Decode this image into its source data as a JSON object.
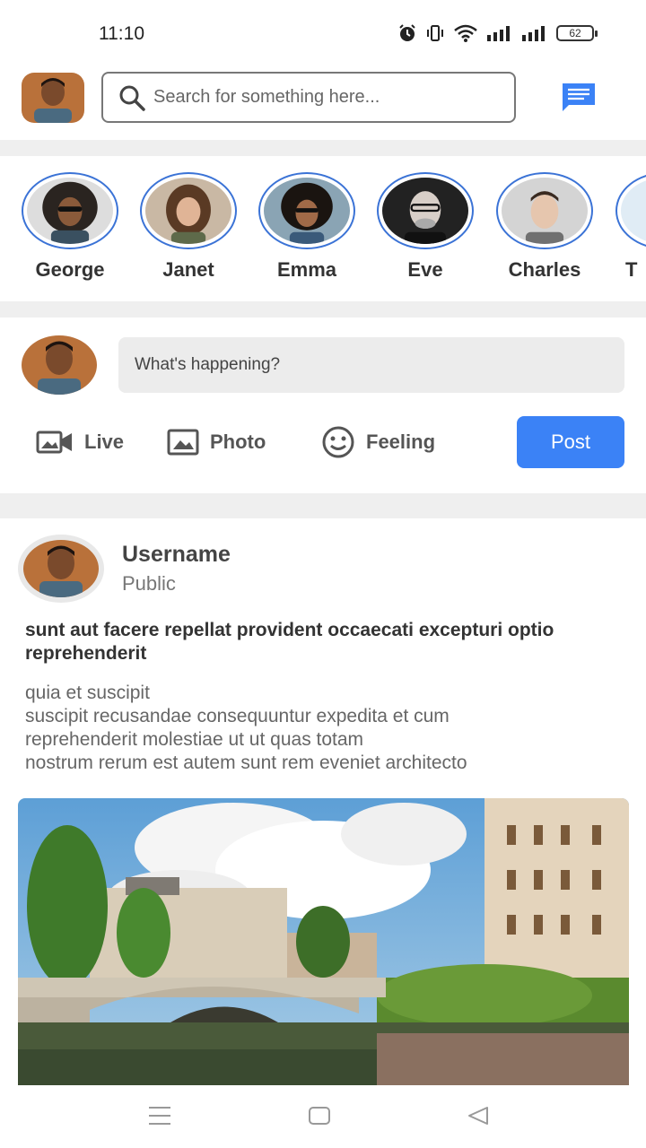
{
  "status_bar": {
    "time": "11:10",
    "battery": "62"
  },
  "header": {
    "search_placeholder": "Search for something here..."
  },
  "stories": [
    {
      "name": "George",
      "bg": "#3a3a3a"
    },
    {
      "name": "Janet",
      "bg": "#b48a6a"
    },
    {
      "name": "Emma",
      "bg": "#6f8fa8"
    },
    {
      "name": "Eve",
      "bg": "#2e2e2e"
    },
    {
      "name": "Charles",
      "bg": "#c8c8c8"
    },
    {
      "name": "T",
      "bg": "#e0ecf5"
    }
  ],
  "composer": {
    "placeholder": "What's happening?",
    "live_label": "Live",
    "photo_label": "Photo",
    "feeling_label": "Feeling",
    "post_label": "Post"
  },
  "post": {
    "username": "Username",
    "visibility": "Public",
    "title": "sunt aut facere repellat provident occaecati excepturi optio reprehenderit",
    "body": "quia et suscipit\nsuscipit recusandae consequuntur expedita et cum\nreprehenderit molestiae ut ut quas totam\nnostrum rerum est autem sunt rem eveniet architecto"
  },
  "colors": {
    "accent": "#3b82f6",
    "story_ring": "#3b73d6",
    "message_icon": "#3b82f6"
  }
}
